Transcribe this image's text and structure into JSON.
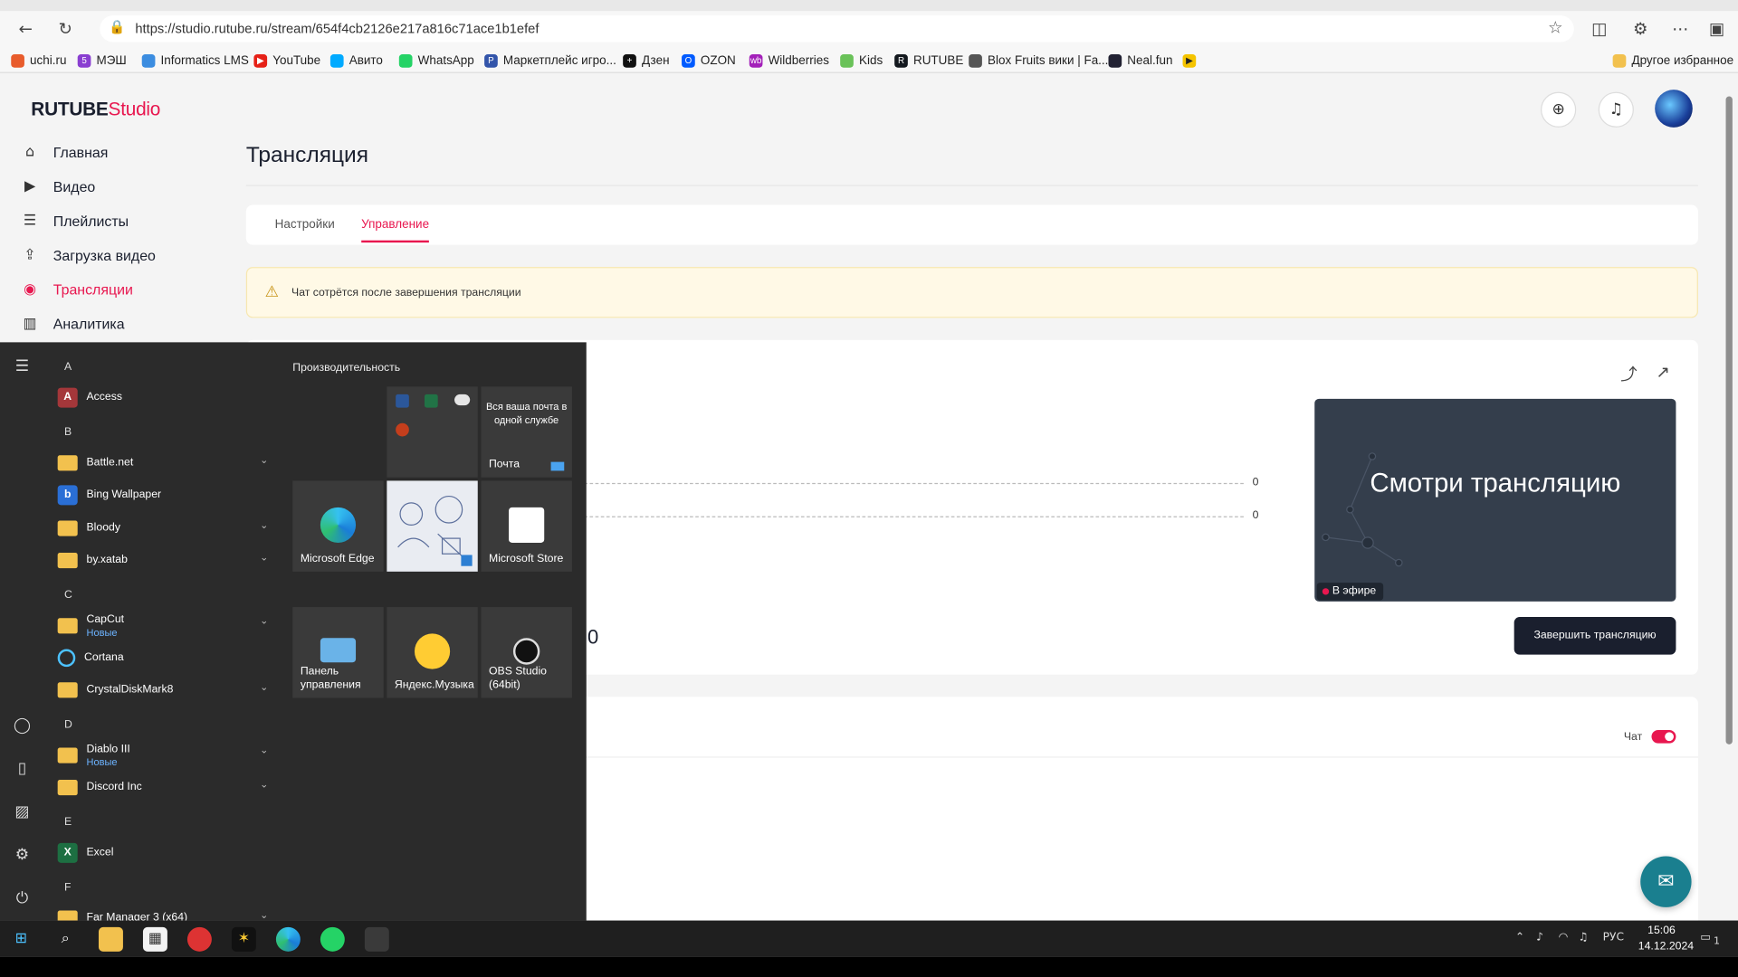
{
  "browser": {
    "url": "https://studio.rutube.ru/stream/654f4cb2126e217a816c71ace1b1efef",
    "bookmarks": [
      "uchi.ru",
      "МЭШ",
      "Informatics LMS",
      "YouTube",
      "Авито",
      "WhatsApp",
      "Маркетплейс игро...",
      "Дзен",
      "OZON",
      "Wildberries",
      "Kids",
      "RUTUBE",
      "Blox Fruits вики | Fa...",
      "Neal.fun"
    ],
    "other_bookmarks": "Другое избранное"
  },
  "studio": {
    "logo_main": "RUTUBE",
    "logo_sub": "Studio",
    "nav": [
      {
        "label": "Главная",
        "icon": "home-icon"
      },
      {
        "label": "Видео",
        "icon": "video-icon"
      },
      {
        "label": "Плейлисты",
        "icon": "playlist-icon"
      },
      {
        "label": "Загрузка видео",
        "icon": "upload-icon"
      },
      {
        "label": "Трансляции",
        "icon": "broadcast-icon"
      },
      {
        "label": "Аналитика",
        "icon": "analytics-icon"
      }
    ],
    "page_title": "Трансляция",
    "tabs": [
      "Настройки",
      "Управление"
    ],
    "alert": "Чат сотрётся после завершения трансляции",
    "stat_values": [
      "0",
      "0"
    ],
    "big_value": "0",
    "preview_text": "Смотри трансляцию",
    "live_badge": "В эфире",
    "end_button": "Завершить трансляцию",
    "chat_label": "Чат",
    "accent": "#e8174f"
  },
  "start_menu": {
    "tiles_heading": "Производительность",
    "apps": [
      {
        "letter": "A"
      },
      {
        "name": "Access",
        "icon": "access-icon"
      },
      {
        "letter": "B"
      },
      {
        "name": "Battle.net",
        "folder": true
      },
      {
        "name": "Bing Wallpaper",
        "icon": "bing-icon"
      },
      {
        "name": "Bloody",
        "folder": true
      },
      {
        "name": "by.xatab",
        "folder": true
      },
      {
        "letter": "C"
      },
      {
        "name": "CapCut",
        "sub": "Новые",
        "folder": true
      },
      {
        "name": "Cortana",
        "icon": "cortana-icon"
      },
      {
        "name": "CrystalDiskMark8",
        "folder": true
      },
      {
        "letter": "D"
      },
      {
        "name": "Diablo III",
        "sub": "Новые",
        "folder": true
      },
      {
        "name": "Discord Inc",
        "folder": true
      },
      {
        "letter": "E"
      },
      {
        "name": "Excel",
        "icon": "excel-icon"
      },
      {
        "letter": "F"
      },
      {
        "name": "Far Manager 3 (x64)",
        "folder": true
      }
    ],
    "tiles": {
      "mail_text": "Вся ваша почта в одной службе",
      "mail_label": "Почта",
      "edge": "Microsoft Edge",
      "store": "Microsoft Store",
      "control_panel": "Панель управления",
      "yandex_music": "Яндекс.Музыка",
      "obs": "OBS Studio (64bit)"
    }
  },
  "taskbar": {
    "lang": "РУС",
    "time": "15:06",
    "date": "14.12.2024",
    "notifications": "1"
  }
}
